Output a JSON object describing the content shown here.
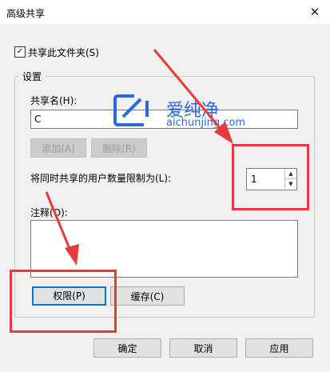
{
  "window": {
    "title": "高级共享",
    "close_glyph": "✕"
  },
  "share_checkbox": {
    "label": "共享此文件夹(S)",
    "checked": true,
    "mark": "✓"
  },
  "settings": {
    "group_title": "设置",
    "share_name_label": "共享名(H):",
    "share_name_value": "C",
    "add_button": "添加(A)",
    "remove_button": "删除(R)",
    "limit_label": "将同时共享的用户数量限制为(L):",
    "limit_value": "1",
    "comment_label": "注释(O):",
    "comment_value": "",
    "permissions_button": "权限(P)",
    "cache_button": "缓存(C)"
  },
  "footer": {
    "ok_button": "确定",
    "cancel_button": "取消",
    "apply_button": "应用"
  },
  "watermark": {
    "title": "爱纯净",
    "url": "aichunjing.com"
  },
  "annotation_color": "#e83a3a"
}
